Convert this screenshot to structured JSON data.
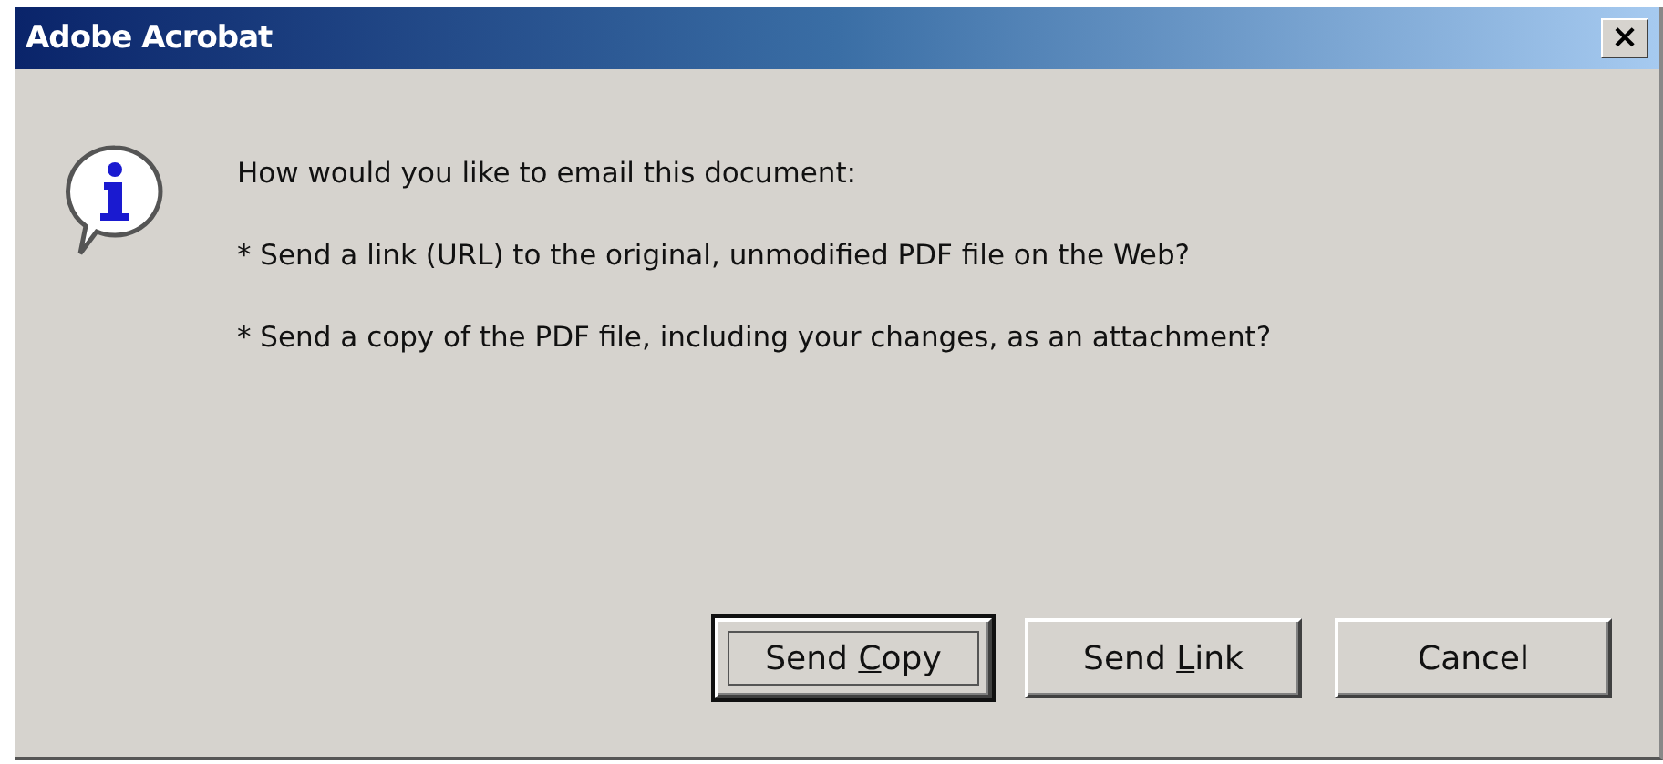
{
  "window": {
    "title": "Adobe Acrobat",
    "close": "×"
  },
  "message": {
    "question": "How would you like to email this document:",
    "options": [
      "* Send a link (URL) to the original, unmodified PDF file on the Web?",
      "* Send a copy of the PDF file, including your changes, as an attachment?"
    ]
  },
  "buttons": [
    {
      "label": [
        {
          "text": "Send ",
          "underlined": false
        },
        {
          "text": "C",
          "underlined": true
        },
        {
          "text": "opy",
          "underlined": false
        }
      ],
      "default": true
    },
    {
      "label": [
        {
          "text": "Send ",
          "underlined": false
        },
        {
          "text": "L",
          "underlined": true
        },
        {
          "text": "ink",
          "underlined": false
        }
      ],
      "default": false
    },
    {
      "label": [
        {
          "text": "Cancel",
          "underlined": false
        }
      ],
      "default": false
    }
  ]
}
